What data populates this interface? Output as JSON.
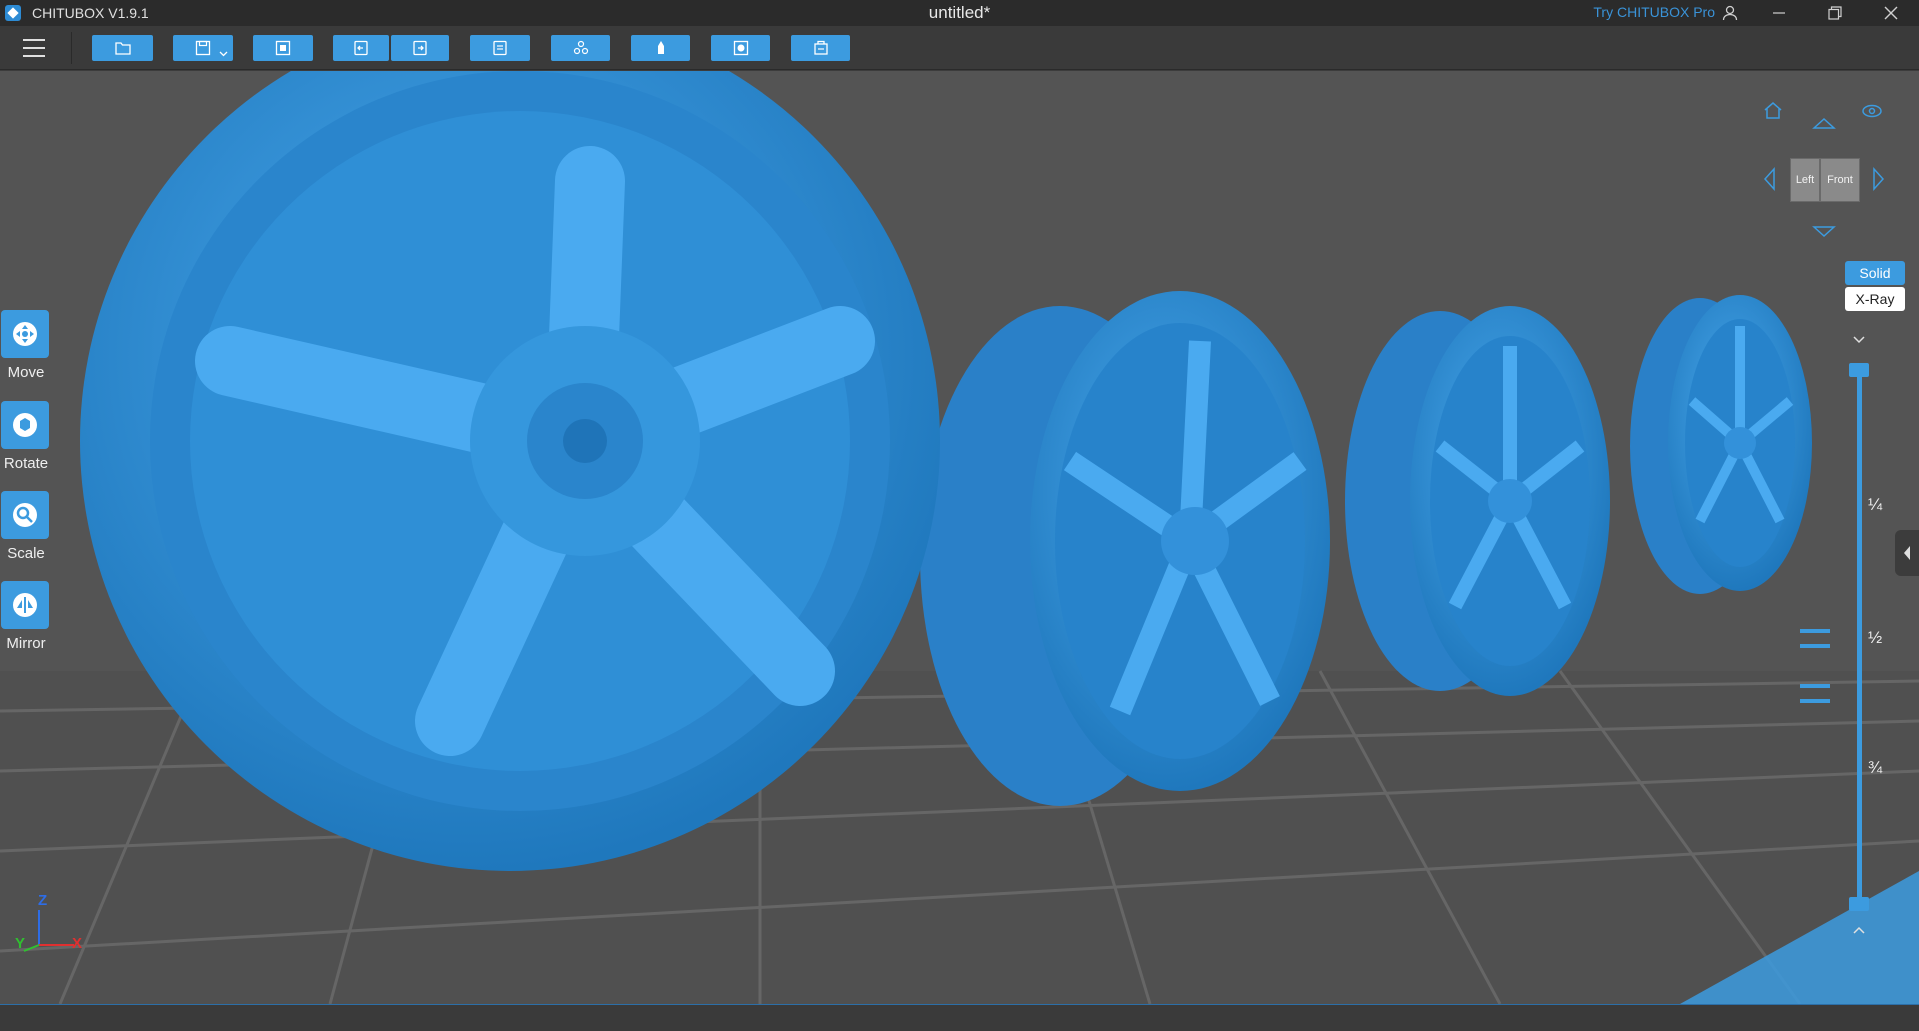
{
  "app": {
    "name": "CHITUBOX V1.9.1",
    "document_title": "untitled*",
    "try_pro": "Try CHITUBOX Pro"
  },
  "toolbar": {
    "buttons": [
      {
        "name": "open-file",
        "icon": "folder-icon"
      },
      {
        "name": "save",
        "icon": "save-icon"
      },
      {
        "name": "screenshot",
        "icon": "frame-icon"
      },
      {
        "name": "undo",
        "icon": "undo-icon"
      },
      {
        "name": "redo",
        "icon": "redo-icon"
      },
      {
        "name": "settings",
        "icon": "settings-icon"
      },
      {
        "name": "supports",
        "icon": "supports-icon"
      },
      {
        "name": "hollow",
        "icon": "hollow-icon"
      },
      {
        "name": "dig-hole",
        "icon": "hole-icon"
      },
      {
        "name": "slice",
        "icon": "slice-icon"
      }
    ]
  },
  "tools": {
    "move": "Move",
    "rotate": "Rotate",
    "scale": "Scale",
    "mirror": "Mirror"
  },
  "view_cube": {
    "left": "Left",
    "front": "Front"
  },
  "render_modes": {
    "solid": "Solid",
    "xray": "X-Ray",
    "active": "Solid"
  },
  "layer_slider": {
    "quarter": "¼",
    "half": "½",
    "three_quarter": "¾"
  },
  "axes": {
    "z": "Z",
    "y": "Y",
    "x": "X"
  },
  "colors": {
    "accent": "#3c9bdf",
    "model": "#2f8fd6",
    "background": "#545454",
    "grid": "#6a6a6a"
  }
}
